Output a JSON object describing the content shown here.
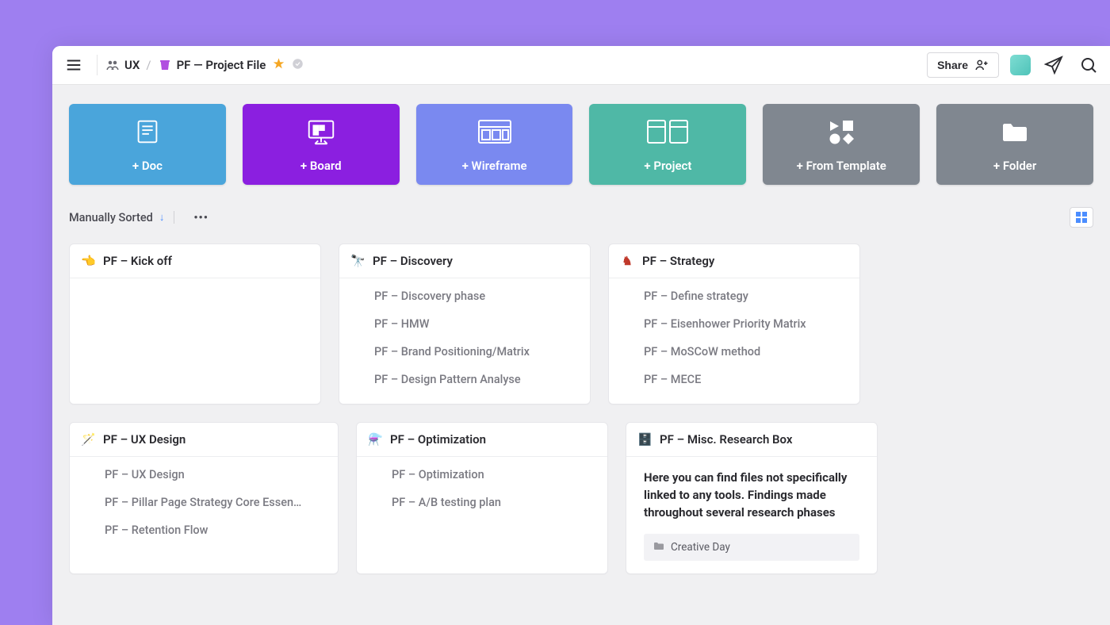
{
  "breadcrumb": {
    "team_label": "UX",
    "project_label": "PF — Project File"
  },
  "header": {
    "share_label": "Share"
  },
  "create_tiles": [
    {
      "label": "+ Doc",
      "color": "#4aa5db"
    },
    {
      "label": "+ Board",
      "color": "#8b1fe0"
    },
    {
      "label": "+ Wireframe",
      "color": "#7a89f0"
    },
    {
      "label": "+ Project",
      "color": "#4fb8a6"
    },
    {
      "label": "+ From Template",
      "color": "#808790"
    },
    {
      "label": "+ Folder",
      "color": "#808790"
    }
  ],
  "sort": {
    "label": "Manually Sorted"
  },
  "cards": [
    {
      "emoji": "👈",
      "title": "PF – Kick off",
      "items": []
    },
    {
      "emoji": "🔭",
      "title": "PF – Discovery",
      "items": [
        "PF – Discovery phase",
        "PF – HMW",
        "PF – Brand Positioning/Matrix",
        "PF – Design Pattern Analyse"
      ]
    },
    {
      "emoji": "♞",
      "title": "PF – Strategy",
      "items": [
        "PF – Define strategy",
        "PF – Eisenhower Priority Matrix",
        "PF – MoSCoW method",
        "PF – MECE"
      ]
    },
    {
      "emoji": "🪄",
      "title": "PF – UX Design",
      "items": [
        "PF – UX Design",
        "PF – Pillar Page Strategy Core Essen…",
        "PF – Retention Flow"
      ]
    },
    {
      "emoji": "⚗️",
      "title": "PF – Optimization",
      "items": [
        "PF – Optimization",
        "PF – A/B testing plan"
      ]
    },
    {
      "emoji": "🗄️",
      "title": "PF – Misc. Research Box",
      "description": "Here you can find files not specifically linked to any tools. Findings made throughout several research phases",
      "chip": "Creative Day"
    }
  ]
}
